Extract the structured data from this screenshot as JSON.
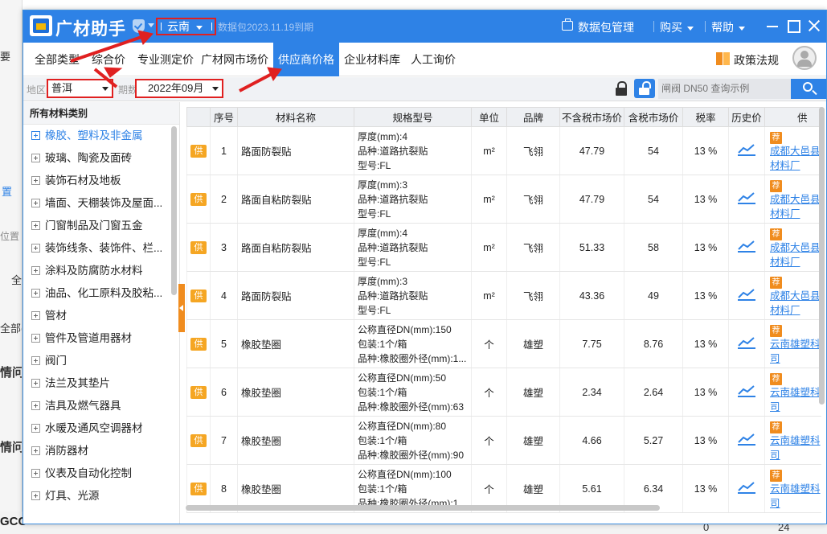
{
  "background": {
    "left_fragments": [
      "要",
      "置",
      "位置",
      "全",
      "全部(",
      "情问",
      "情问",
      "GCC"
    ],
    "bottom_numbers": [
      "0",
      "24"
    ]
  },
  "titlebar": {
    "app_name": "广材助手",
    "region": "云南",
    "expiry": "数据包2023.11.19到期",
    "data_package": "数据包管理",
    "buy": "购买",
    "help": "帮助"
  },
  "nav": {
    "tabs": [
      {
        "label": "全部类型",
        "active": false
      },
      {
        "label": "综合价",
        "active": false
      },
      {
        "label": "专业测定价",
        "active": false
      },
      {
        "label": "广材网市场价",
        "active": false
      },
      {
        "label": "供应商价格",
        "active": true
      },
      {
        "label": "企业材料库",
        "active": false
      },
      {
        "label": "人工询价",
        "active": false
      }
    ],
    "policy": "政策法规"
  },
  "filters": {
    "area_label": "地区",
    "area_value": "普洱",
    "period_label": "期数",
    "period_value": "2022年09月",
    "search_placeholder": "闸阀 DN50 查询示例"
  },
  "sidebar": {
    "header": "所有材料类别",
    "items": [
      "橡胶、塑料及非金属",
      "玻璃、陶瓷及面砖",
      "装饰石材及地板",
      "墙面、天棚装饰及屋面...",
      "门窗制品及门窗五金",
      "装饰线条、装饰件、栏...",
      "涂料及防腐防水材料",
      "油品、化工原料及胶粘...",
      "管材",
      "管件及管道用器材",
      "阀门",
      "法兰及其垫片",
      "洁具及燃气器具",
      "水暖及通风空调器材",
      "消防器材",
      "仪表及自动化控制",
      "灯具、光源"
    ]
  },
  "table": {
    "columns": [
      "",
      "序号",
      "材料名称",
      "规格型号",
      "单位",
      "品牌",
      "不含税市场价",
      "含税市场价",
      "税率",
      "历史价",
      "供"
    ],
    "supply_badge": "供",
    "recommend_badge": "荐",
    "rows": [
      {
        "no": "1",
        "name": "路面防裂贴",
        "spec": [
          "厚度(mm):4",
          "品种:道路抗裂贴",
          "型号:FL"
        ],
        "unit": "m²",
        "brand": "飞翎",
        "price_ex": "47.79",
        "price_in": "54",
        "tax": "13 %",
        "supplier": [
          "成都大邑县",
          "材料厂"
        ]
      },
      {
        "no": "2",
        "name": "路面自粘防裂贴",
        "spec": [
          "厚度(mm):3",
          "品种:道路抗裂贴",
          "型号:FL"
        ],
        "unit": "m²",
        "brand": "飞翎",
        "price_ex": "47.79",
        "price_in": "54",
        "tax": "13 %",
        "supplier": [
          "成都大邑县",
          "材料厂"
        ]
      },
      {
        "no": "3",
        "name": "路面自粘防裂贴",
        "spec": [
          "厚度(mm):4",
          "品种:道路抗裂贴",
          "型号:FL"
        ],
        "unit": "m²",
        "brand": "飞翎",
        "price_ex": "51.33",
        "price_in": "58",
        "tax": "13 %",
        "supplier": [
          "成都大邑县",
          "材料厂"
        ]
      },
      {
        "no": "4",
        "name": "路面防裂贴",
        "spec": [
          "厚度(mm):3",
          "品种:道路抗裂贴",
          "型号:FL"
        ],
        "unit": "m²",
        "brand": "飞翎",
        "price_ex": "43.36",
        "price_in": "49",
        "tax": "13 %",
        "supplier": [
          "成都大邑县",
          "材料厂"
        ]
      },
      {
        "no": "5",
        "name": "橡胶垫圈",
        "spec": [
          "公称直径DN(mm):150",
          "包装:1个/箱",
          "品种:橡胶圈外径(mm):1..."
        ],
        "unit": "个",
        "brand": "雄塑",
        "price_ex": "7.75",
        "price_in": "8.76",
        "tax": "13 %",
        "supplier": [
          "云南雄塑科",
          "司"
        ]
      },
      {
        "no": "6",
        "name": "橡胶垫圈",
        "spec": [
          "公称直径DN(mm):50",
          "包装:1个/箱",
          "品种:橡胶圈外径(mm):63"
        ],
        "unit": "个",
        "brand": "雄塑",
        "price_ex": "2.34",
        "price_in": "2.64",
        "tax": "13 %",
        "supplier": [
          "云南雄塑科",
          "司"
        ]
      },
      {
        "no": "7",
        "name": "橡胶垫圈",
        "spec": [
          "公称直径DN(mm):80",
          "包装:1个/箱",
          "品种:橡胶圈外径(mm):90"
        ],
        "unit": "个",
        "brand": "雄塑",
        "price_ex": "4.66",
        "price_in": "5.27",
        "tax": "13 %",
        "supplier": [
          "云南雄塑科",
          "司"
        ]
      },
      {
        "no": "8",
        "name": "橡胶垫圈",
        "spec": [
          "公称直径DN(mm):100",
          "包装:1个/箱",
          "品种:橡胶圈外径(mm):1..."
        ],
        "unit": "个",
        "brand": "雄塑",
        "price_ex": "5.61",
        "price_in": "6.34",
        "tax": "13 %",
        "supplier": [
          "云南雄塑科",
          "司"
        ]
      }
    ]
  },
  "colors": {
    "primary": "#2e82e6",
    "annotation": "#e02020",
    "badge_orange": "#f5a623"
  }
}
